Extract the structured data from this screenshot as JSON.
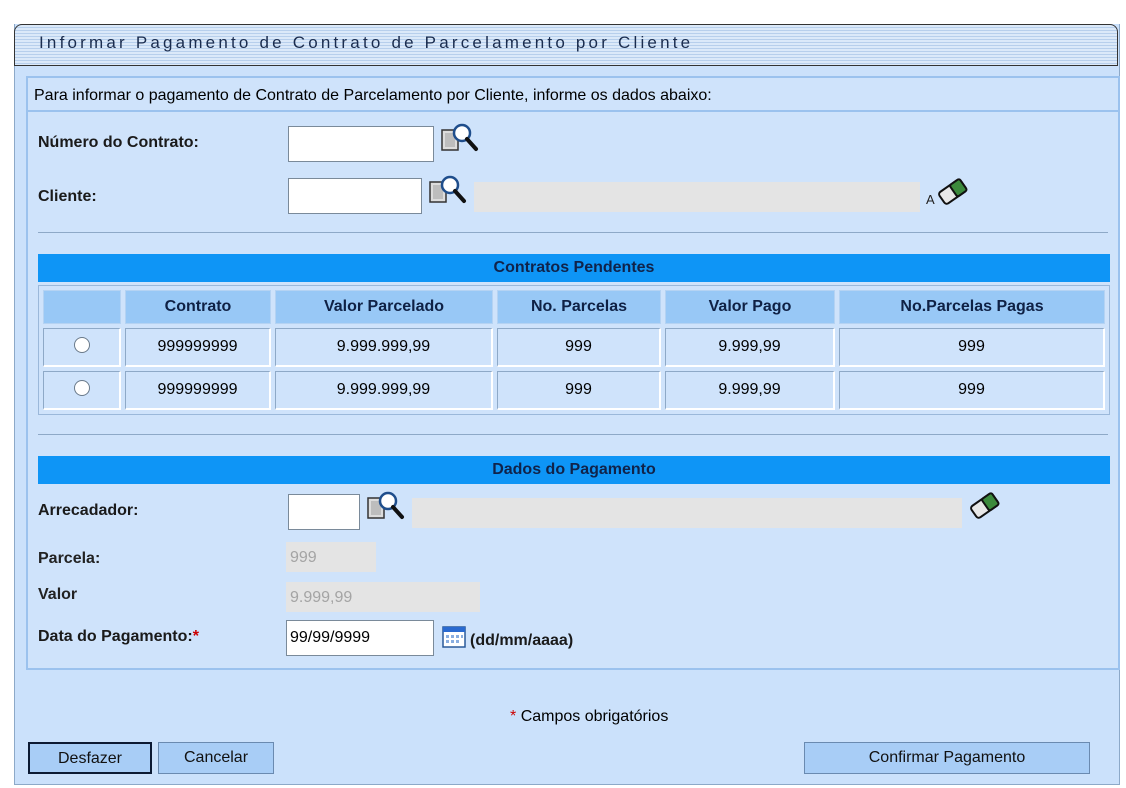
{
  "title": "Informar Pagamento de Contrato de Parcelamento por Cliente",
  "intro": "Para informar o pagamento de Contrato de Parcelamento por Cliente, informe os dados abaixo:",
  "fields": {
    "numero_contrato": {
      "label": "Número do Contrato:",
      "value": ""
    },
    "cliente": {
      "label": "Cliente:",
      "value": "",
      "name_value": ""
    }
  },
  "contracts": {
    "header": "Contratos Pendentes",
    "columns": [
      "",
      "Contrato",
      "Valor Parcelado",
      "No. Parcelas",
      "Valor Pago",
      "No.Parcelas Pagas"
    ],
    "rows": [
      [
        "999999999",
        "9.999.999,99",
        "999",
        "9.999,99",
        "999"
      ],
      [
        "999999999",
        "9.999.999,99",
        "999",
        "9.999,99",
        "999"
      ]
    ]
  },
  "payment": {
    "header": "Dados do Pagamento",
    "arrecadador": {
      "label": "Arrecadador:",
      "value": "",
      "name_value": ""
    },
    "parcela": {
      "label": "Parcela:",
      "value": "999"
    },
    "valor": {
      "label": "Valor",
      "value": "9.999,99"
    },
    "data": {
      "label": "Data do Pagamento:",
      "required_mark": "*",
      "value": "99/99/9999",
      "format_hint": "(dd/mm/aaaa)"
    }
  },
  "footer": {
    "required_mark": "*",
    "required_note": "Campos obrigatórios"
  },
  "buttons": {
    "undo": "Desfazer",
    "cancel": "Cancelar",
    "confirm": "Confirmar Pagamento"
  },
  "colors": {
    "panel": "#cfe3fb",
    "section_header": "#0e95f6",
    "table_header": "#98c8f6",
    "button": "#a8cdf6",
    "required": "#cc0000"
  },
  "icons": [
    "search-icon",
    "eraser-icon",
    "calendar-icon"
  ]
}
